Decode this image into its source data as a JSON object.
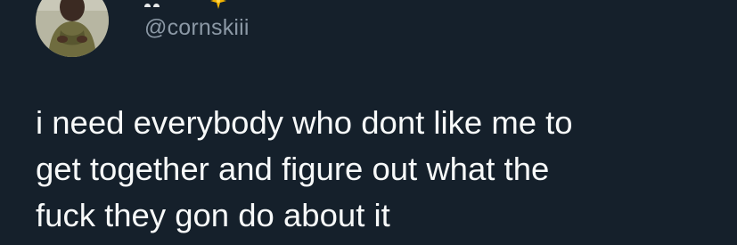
{
  "tweet": {
    "handle": "@cornskiii",
    "text": "i need everybody who dont like me to\nget together and figure out what the\nfuck they gon do about it"
  },
  "icons": {
    "avatar": "profile-photo",
    "badge": "sparkle-badge-icon"
  },
  "colors": {
    "background": "#15202b",
    "text": "#f7f9f9",
    "handle": "#8b98a5",
    "badge": "#f4b400"
  }
}
